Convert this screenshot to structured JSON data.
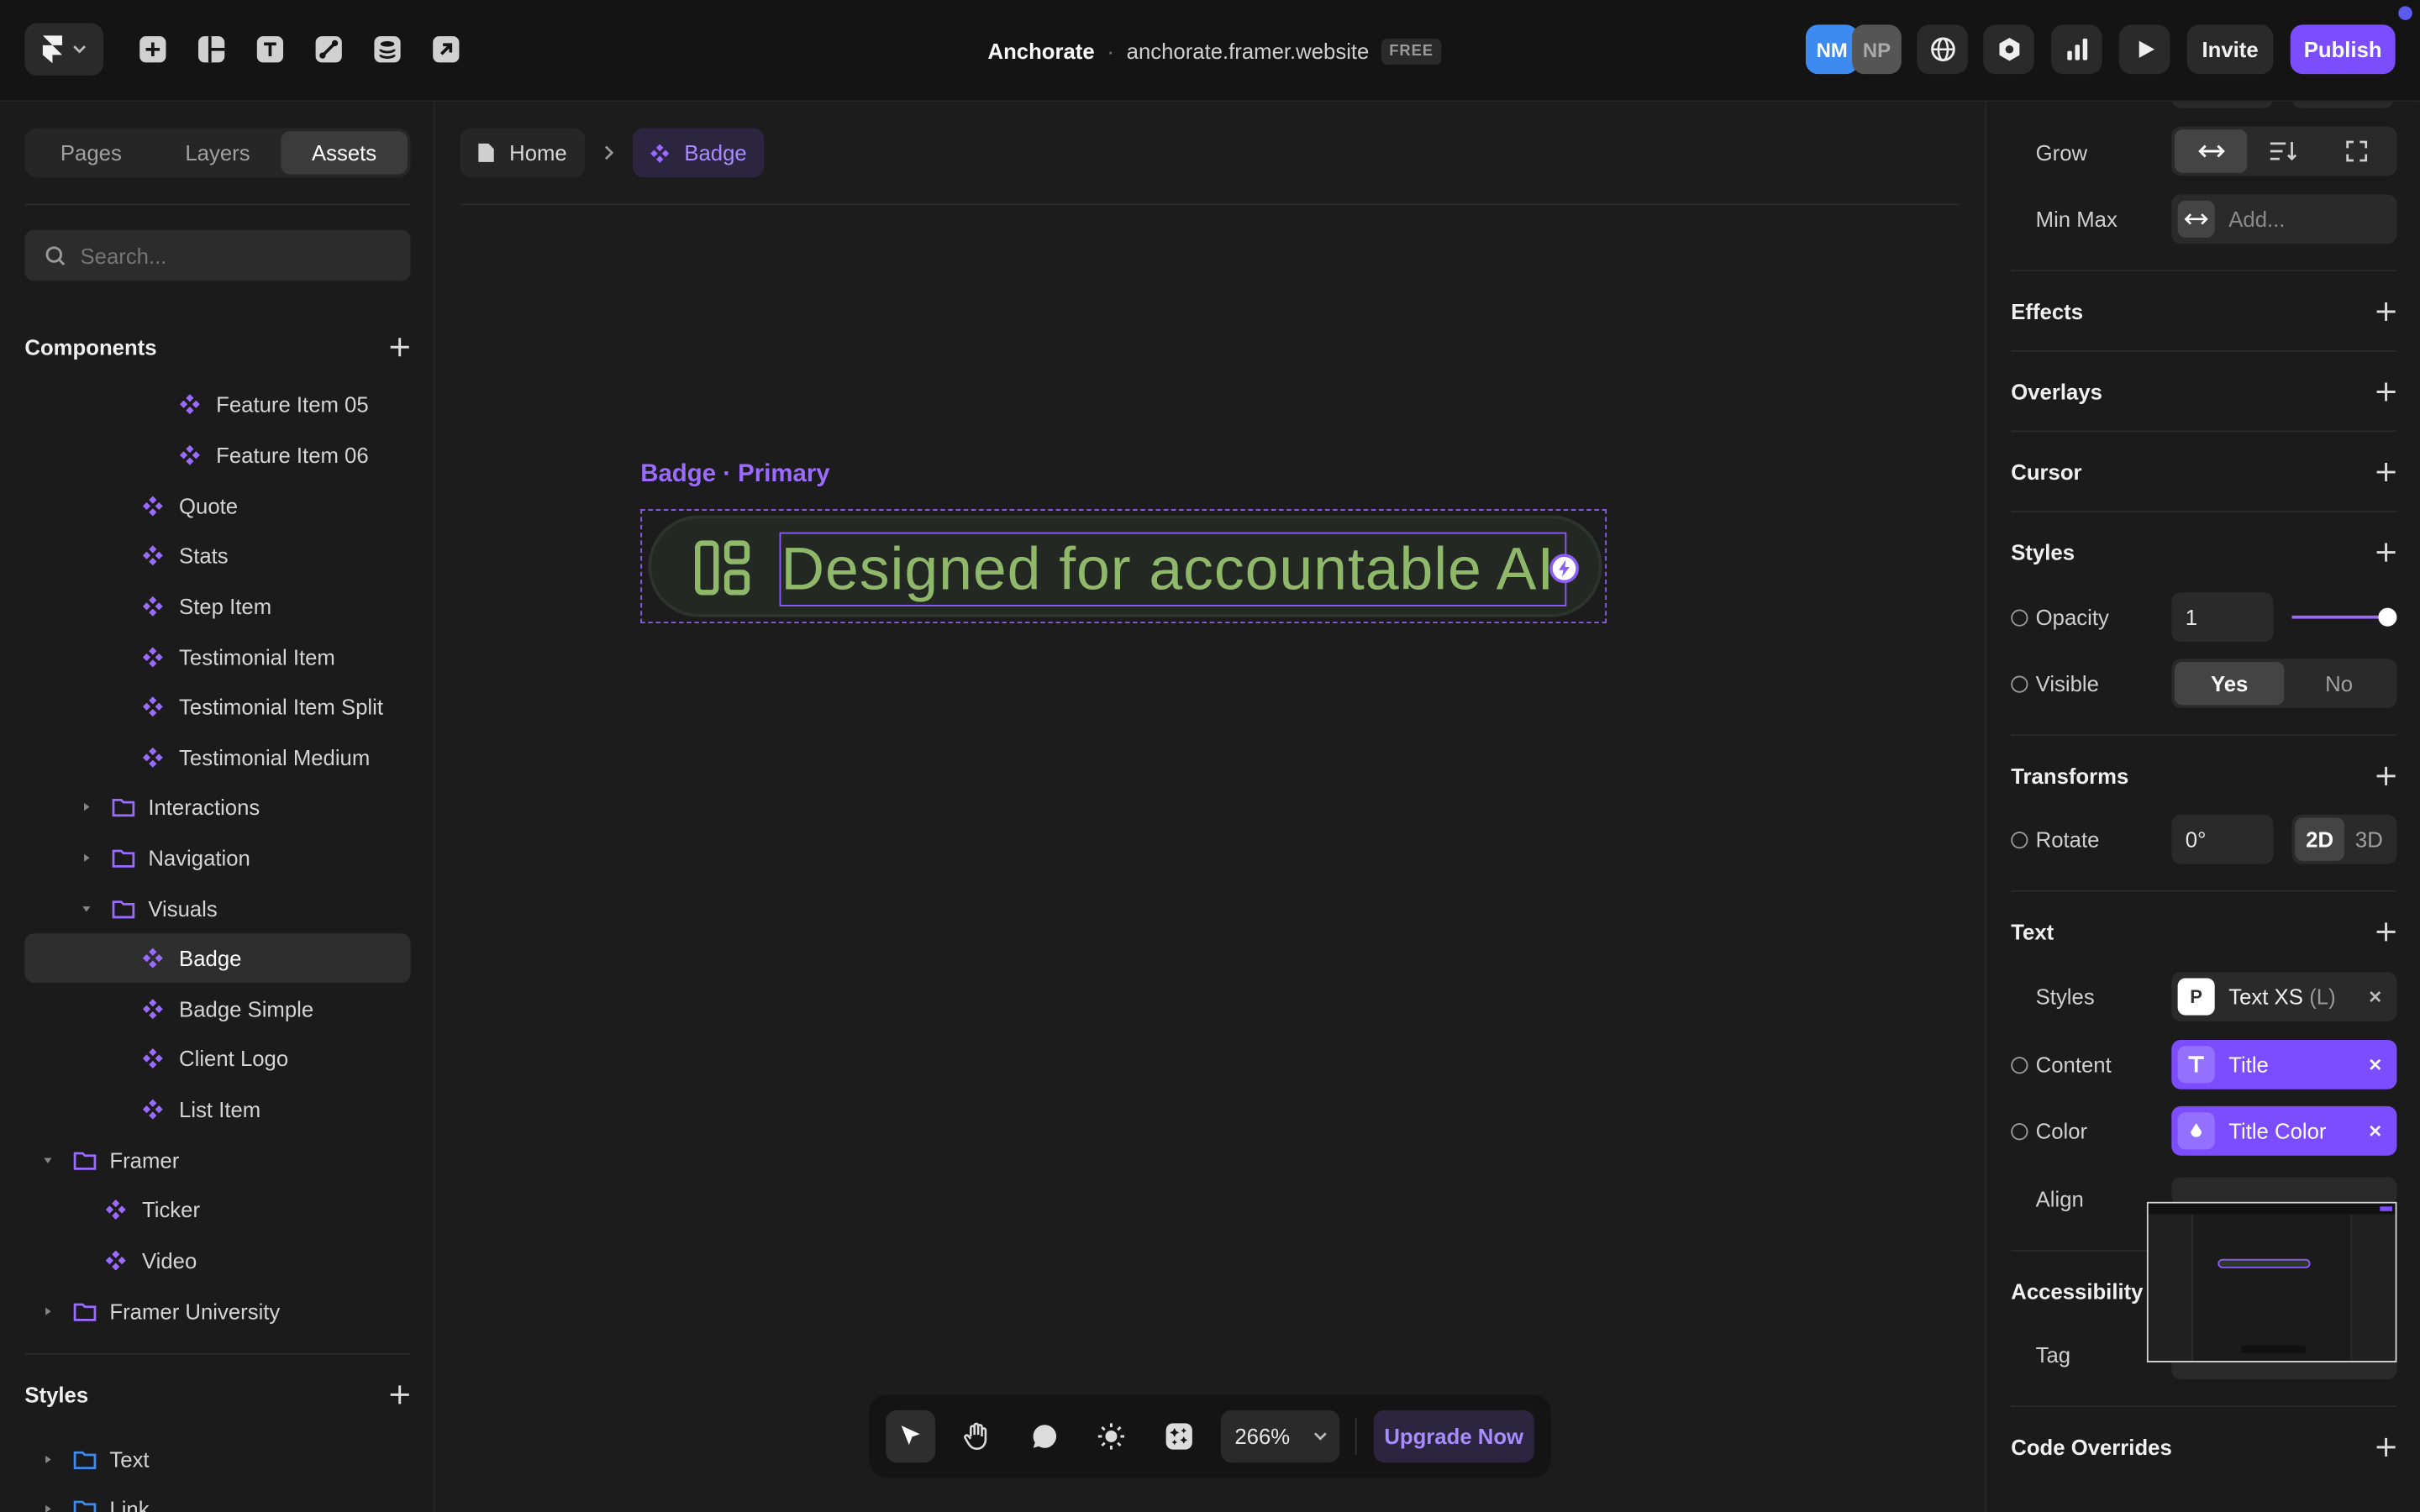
{
  "topbar": {
    "project_name": "Anchorate",
    "separator": "·",
    "site_url": "anchorate.framer.website",
    "plan_badge": "FREE",
    "avatars": [
      {
        "initials": "NM",
        "color": "#3d8bf0"
      },
      {
        "initials": "NP",
        "color": "#555555"
      }
    ],
    "invite_label": "Invite",
    "publish_label": "Publish"
  },
  "left_panel": {
    "tabs": [
      {
        "label": "Pages"
      },
      {
        "label": "Layers"
      },
      {
        "label": "Assets",
        "active": true
      }
    ],
    "search_placeholder": "Search...",
    "components_title": "Components",
    "tree": [
      {
        "label": "Feature Item 05"
      },
      {
        "label": "Feature Item 06"
      },
      {
        "label": "Quote"
      },
      {
        "label": "Stats"
      },
      {
        "label": "Step Item"
      },
      {
        "label": "Testimonial Item"
      },
      {
        "label": "Testimonial Item Split"
      },
      {
        "label": "Testimonial Medium"
      },
      {
        "label": "Interactions"
      },
      {
        "label": "Navigation"
      },
      {
        "label": "Visuals"
      },
      {
        "label": "Badge"
      },
      {
        "label": "Badge Simple"
      },
      {
        "label": "Client Logo"
      },
      {
        "label": "List Item"
      },
      {
        "label": "Framer"
      },
      {
        "label": "Ticker"
      },
      {
        "label": "Video"
      },
      {
        "label": "Framer University"
      }
    ],
    "styles_title": "Styles",
    "styles_tree": [
      {
        "label": "Text"
      },
      {
        "label": "Link"
      }
    ]
  },
  "canvas": {
    "breadcrumb": {
      "home": "Home",
      "current": "Badge"
    },
    "frame_label": "Badge · Primary",
    "badge_text": "Designed for accountable AI",
    "toolbar": {
      "zoom": "266%",
      "upgrade_label": "Upgrade Now"
    }
  },
  "right_panel": {
    "grow_label": "Grow",
    "minmax_label": "Min Max",
    "minmax_placeholder": "Add...",
    "sections": {
      "effects": "Effects",
      "overlays": "Overlays",
      "cursor": "Cursor",
      "styles": "Styles",
      "transforms": "Transforms",
      "text": "Text",
      "accessibility": "Accessibility",
      "code_overrides": "Code Overrides"
    },
    "opacity": {
      "label": "Opacity",
      "value": "1",
      "level": 1.0
    },
    "visible": {
      "label": "Visible",
      "yes": "Yes",
      "no": "No"
    },
    "rotate": {
      "label": "Rotate",
      "value": "0°",
      "mode_2d": "2D",
      "mode_3d": "3D"
    },
    "text_styles": {
      "label": "Styles",
      "icon_letter": "P",
      "value": "Text XS",
      "suffix": "(L)"
    },
    "content": {
      "label": "Content",
      "value": "Title"
    },
    "color": {
      "label": "Color",
      "value": "Title Color"
    },
    "align_label": "Align",
    "tag_label": "Tag"
  },
  "colors": {
    "accent": "#8b5cf6",
    "publish": "#7c4dff",
    "badge_text": "#8fb86a"
  }
}
